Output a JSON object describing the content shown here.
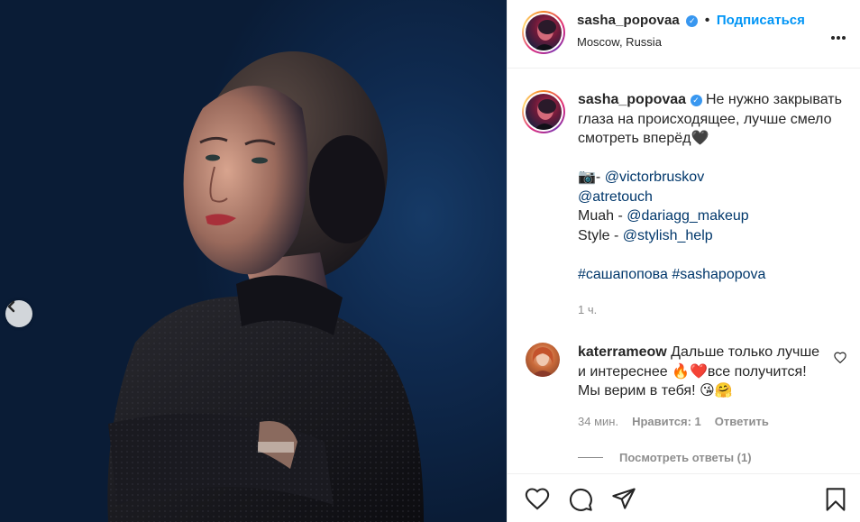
{
  "post": {
    "author": "sasha_popovaa",
    "location": "Moscow, Russia",
    "follow_label": "Подписаться",
    "verified_mark": "✓"
  },
  "caption": {
    "author": "sasha_popovaa",
    "line1": "Не нужно закрывать глаза на происходящее, лучше смело смотреть вперёд🖤",
    "credit_photo_prefix": "📷- ",
    "credit_photo": "@victorbruskov",
    "credit_retouch": "@atretouch",
    "muah_prefix": "Muah - ",
    "muah": "@dariagg_makeup",
    "style_prefix": "Style - ",
    "style": "@stylish_help",
    "hashtag1": "#сашапопова",
    "hashtag2": "#sashapopova",
    "time": "1 ч."
  },
  "comment": {
    "author": "katerrameow",
    "text": "Дальше только лучше и интереснее 🔥❤️все получится! Мы верим в тебя! 😘🤗",
    "time": "34 мин.",
    "likes": "Нравится: 1",
    "reply": "Ответить",
    "view_replies": "Посмотреть ответы (1)"
  },
  "icons": {
    "more": "more-horizontal-icon",
    "prev": "chevron-left-icon",
    "like": "heart-icon",
    "comment": "comment-icon",
    "share": "paper-plane-icon",
    "save": "bookmark-icon"
  },
  "colors": {
    "accent": "#0095f6",
    "link": "#00376b",
    "muted": "#8e8e8e",
    "photo_bg": "#0f2a4f"
  }
}
